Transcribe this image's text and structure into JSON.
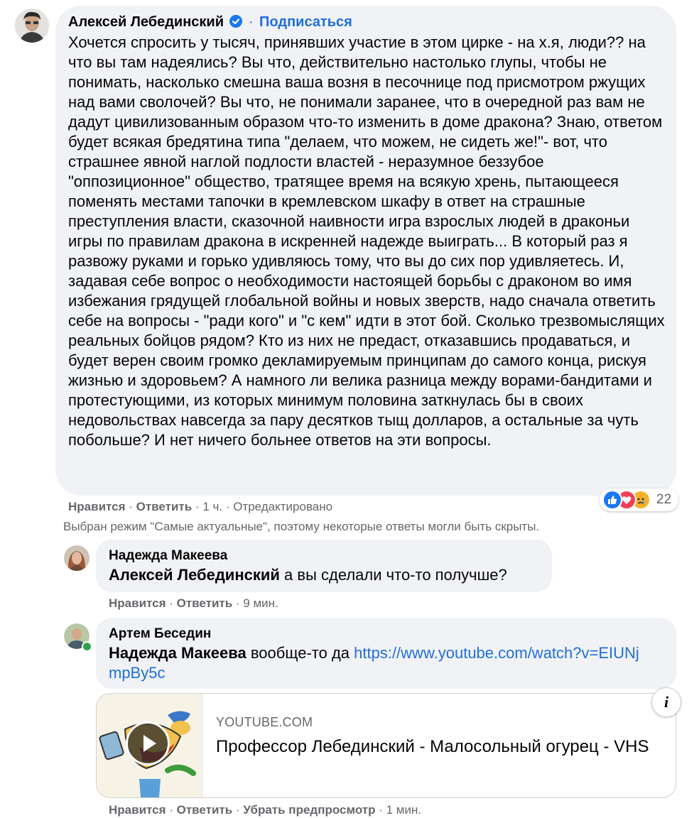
{
  "colors": {
    "bubble": "#f0f2f5",
    "link": "#216fdb",
    "meta": "#65676b",
    "verified": "#1877f2",
    "like": "#1877f2",
    "love": "#f33e58",
    "sad": "#f7b125"
  },
  "comment1": {
    "author": "Алексей Лебединский",
    "verified_icon": "verified-badge-icon",
    "separator": "·",
    "follow_label": "Подписаться",
    "text": "Хочется спросить у тысяч, принявших участие в этом цирке - на х.я, люди?? на что вы там надеялись? Вы что, действительно настолько глупы, чтобы не понимать, насколько смешна ваша возня в песочнице под присмотром ржущих над вами сволочей? Вы что, не понимали заранее, что в очередной раз вам не дадут цивилизованным образом что-то изменить в доме дракона? Знаю, ответом будет всякая бредятина типа \"делаем, что можем, не сидеть же!\"- вот, что страшнее явной наглой подлости властей - неразумное беззубое \"оппозиционное\" общество, тратящее время на всякую хрень, пытающееся поменять местами тапочки в кремлевском шкафу в ответ на страшные преступления власти, сказочной наивности игра взрослых людей в драконьи игры по правилам дракона в искренней надежде выиграть... В который раз я развожу руками и горько удивляюсь тому, что вы до сих пор удивляетесь. И, задавая себе вопрос о необходимости настоящей борьбы с драконом во имя избежания грядущей глобальной войны и новых зверств, надо сначала ответить себе на вопросы - \"ради кого\" и \"с кем\" идти в этот бой. Сколько трезвомыслящих реальных бойцов рядом? Кто из них не предаст, отказавшись продаваться, и будет верен своим громко декламируемым принципам до самого конца, рискуя жизнью и здоровьем? А намного ли велика разница между ворами-бандитами и протестующими, из которых минимум половина заткнулась бы в своих недовольствах навсегда за пару десятков тыщ долларов, а остальные за чуть побольше? И нет ничего больнее ответов на эти вопросы.",
    "like_label": "Нравится",
    "reply_label": "Ответить",
    "time": "1 ч.",
    "edited": "Отредактировано",
    "reactions_count": "22",
    "reaction_icons": [
      "like-reaction-icon",
      "love-reaction-icon",
      "sad-reaction-icon"
    ]
  },
  "notice": "Выбран режим \"Самые актуальные\", поэтому некоторые ответы могли быть скрыты.",
  "reply1": {
    "author": "Надежда Макеева",
    "mention": "Алексей Лебединский",
    "text": " а вы сделали что-то получше?",
    "like_label": "Нравится",
    "reply_label": "Ответить",
    "time": "9 мин."
  },
  "reply2": {
    "author": "Артем Беседин",
    "mention": "Надежда Макеева",
    "text": " вообще-то да ",
    "link_text": "https://www.youtube.com/watch?v=EIUNjmpBy5c",
    "preview": {
      "domain": "YOUTUBE.COM",
      "title": "Профессор Лебединский - Малосольный огурец - VHS",
      "info_icon": "info-icon",
      "play_icon": "play-icon"
    },
    "like_label": "Нравится",
    "reply_label": "Ответить",
    "remove_preview_label": "Убрать предпросмотр",
    "time": "1 мин."
  }
}
